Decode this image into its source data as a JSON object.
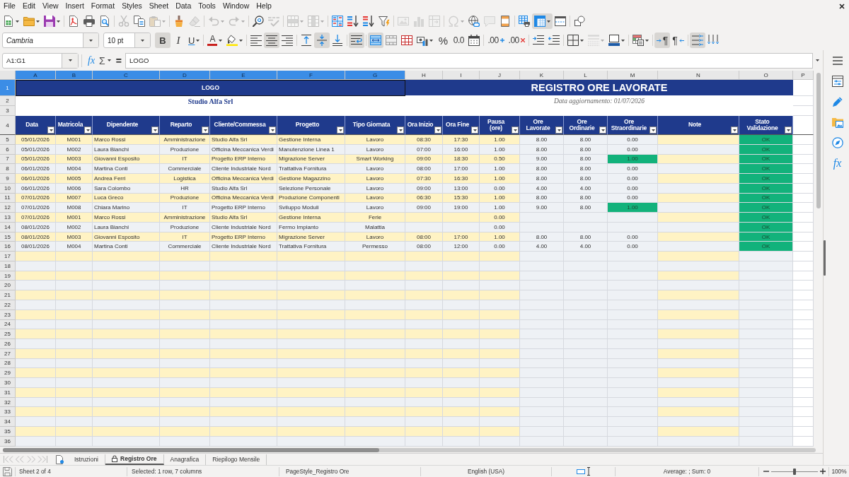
{
  "menu_bar": {
    "items": [
      "File",
      "Edit",
      "View",
      "Insert",
      "Format",
      "Styles",
      "Sheet",
      "Data",
      "Tools",
      "Window",
      "Help"
    ]
  },
  "standard_toolbar": [
    [
      {
        "kind": "new",
        "menu": true,
        "pressed": false,
        "disabled": false
      },
      {
        "kind": "open",
        "menu": true,
        "pressed": false,
        "disabled": false
      },
      {
        "kind": "save",
        "menu": true,
        "pressed": false,
        "disabled": false
      }
    ],
    [
      {
        "kind": "pdf",
        "menu": false,
        "pressed": false,
        "disabled": false
      },
      {
        "kind": "print",
        "menu": false,
        "pressed": false,
        "disabled": false
      },
      {
        "kind": "preview",
        "menu": false,
        "pressed": false,
        "disabled": false
      }
    ],
    [
      {
        "kind": "cut",
        "menu": false,
        "pressed": false,
        "disabled": true
      },
      {
        "kind": "copy",
        "menu": false,
        "pressed": false,
        "disabled": false
      },
      {
        "kind": "paste",
        "menu": true,
        "pressed": false,
        "disabled": true
      }
    ],
    [
      {
        "kind": "clone",
        "menu": false,
        "pressed": false,
        "disabled": false
      },
      {
        "kind": "clear",
        "menu": false,
        "pressed": false,
        "disabled": true
      }
    ],
    [
      {
        "kind": "undo",
        "menu": true,
        "pressed": false,
        "disabled": true
      },
      {
        "kind": "redo",
        "menu": true,
        "pressed": false,
        "disabled": true
      }
    ],
    [
      {
        "kind": "find",
        "menu": false,
        "pressed": false,
        "disabled": false
      },
      {
        "kind": "spelling",
        "menu": false,
        "pressed": false,
        "disabled": true
      }
    ],
    [
      {
        "kind": "rows",
        "menu": true,
        "pressed": false,
        "disabled": true
      },
      {
        "kind": "columns",
        "menu": true,
        "pressed": false,
        "disabled": true
      }
    ],
    [
      {
        "kind": "sort",
        "menu": false,
        "pressed": false,
        "disabled": false
      },
      {
        "kind": "ascending",
        "menu": false,
        "pressed": false,
        "disabled": false
      },
      {
        "kind": "descending",
        "menu": false,
        "pressed": false,
        "disabled": false
      },
      {
        "kind": "autofilter",
        "menu": false,
        "pressed": false,
        "disabled": false
      }
    ],
    [
      {
        "kind": "image",
        "menu": false,
        "pressed": false,
        "disabled": true
      },
      {
        "kind": "chart",
        "menu": false,
        "pressed": false,
        "disabled": true
      },
      {
        "kind": "pivot",
        "menu": false,
        "pressed": false,
        "disabled": true
      }
    ],
    [
      {
        "kind": "symbol",
        "menu": true,
        "pressed": false,
        "disabled": true
      },
      {
        "kind": "hyperlink",
        "menu": false,
        "pressed": false,
        "disabled": false
      },
      {
        "kind": "comment",
        "menu": false,
        "pressed": false,
        "disabled": true
      },
      {
        "kind": "headerfooter",
        "menu": false,
        "pressed": false,
        "disabled": false
      }
    ],
    [
      {
        "kind": "printarea",
        "menu": false,
        "pressed": false,
        "disabled": false
      },
      {
        "kind": "freeze",
        "menu": true,
        "pressed": true,
        "disabled": false
      },
      {
        "kind": "split",
        "menu": false,
        "pressed": false,
        "disabled": false
      }
    ],
    [
      {
        "kind": "shapes",
        "menu": false,
        "pressed": false,
        "disabled": false
      }
    ]
  ],
  "formatting_toolbar": {
    "font_name": "Cambria",
    "font_size": "10 pt",
    "groups": [
      [
        {
          "kind": "bold",
          "label": "B",
          "menu": false,
          "pressed": true,
          "disabled": false
        },
        {
          "kind": "italic",
          "label": "I",
          "menu": false,
          "pressed": false,
          "disabled": false
        },
        {
          "kind": "underline",
          "label": "U",
          "menu": true,
          "pressed": false,
          "disabled": false
        }
      ],
      [
        {
          "kind": "fontcolor",
          "label": "A",
          "menu": true,
          "pressed": false,
          "disabled": false
        },
        {
          "kind": "highlight",
          "menu": true,
          "pressed": false,
          "disabled": false
        }
      ],
      [
        {
          "kind": "left",
          "menu": false,
          "pressed": false,
          "disabled": false
        },
        {
          "kind": "center",
          "menu": false,
          "pressed": true,
          "disabled": false
        },
        {
          "kind": "right",
          "menu": false,
          "pressed": false,
          "disabled": false
        }
      ],
      [
        {
          "kind": "top",
          "menu": false,
          "pressed": false,
          "disabled": false
        },
        {
          "kind": "middle",
          "menu": false,
          "pressed": true,
          "disabled": false
        },
        {
          "kind": "bottom",
          "menu": false,
          "pressed": false,
          "disabled": false
        }
      ],
      [
        {
          "kind": "wrap",
          "menu": false,
          "pressed": true,
          "disabled": false
        }
      ],
      [
        {
          "kind": "mergecenter",
          "menu": false,
          "pressed": true,
          "disabled": false
        },
        {
          "kind": "merge",
          "menu": false,
          "pressed": false,
          "disabled": false
        },
        {
          "kind": "unmerge",
          "menu": false,
          "pressed": false,
          "disabled": false
        },
        {
          "kind": "currency",
          "menu": true,
          "pressed": false,
          "disabled": false
        },
        {
          "kind": "percent",
          "label": "%",
          "menu": false,
          "pressed": false,
          "disabled": false
        },
        {
          "kind": "number",
          "label": "0.0",
          "menu": false,
          "pressed": false,
          "disabled": false
        },
        {
          "kind": "date",
          "menu": false,
          "pressed": false,
          "disabled": false
        }
      ],
      [
        {
          "kind": "adddecimal",
          "label": ".00",
          "menu": false,
          "pressed": false,
          "disabled": false
        },
        {
          "kind": "deletedecimal",
          "label": ".00",
          "menu": false,
          "pressed": false,
          "disabled": false
        }
      ],
      [
        {
          "kind": "indent",
          "menu": false,
          "pressed": false,
          "disabled": false
        },
        {
          "kind": "outdent",
          "menu": false,
          "pressed": false,
          "disabled": false
        }
      ],
      [
        {
          "kind": "borders",
          "menu": true,
          "pressed": false,
          "disabled": false
        },
        {
          "kind": "borderstyle",
          "menu": true,
          "pressed": false,
          "disabled": true
        },
        {
          "kind": "bordercolor",
          "menu": true,
          "pressed": false,
          "disabled": false
        }
      ],
      [
        {
          "kind": "conditional",
          "menu": true,
          "pressed": false,
          "disabled": false
        }
      ],
      [
        {
          "kind": "ltr",
          "label": "¶",
          "menu": false,
          "pressed": true,
          "disabled": false
        },
        {
          "kind": "rtl",
          "label": "¶",
          "menu": false,
          "pressed": false,
          "disabled": false
        }
      ],
      [
        {
          "kind": "horizontal",
          "menu": false,
          "pressed": true,
          "disabled": false
        },
        {
          "kind": "vertical",
          "menu": false,
          "pressed": false,
          "disabled": false
        }
      ]
    ]
  },
  "formula_bar": {
    "name_box": "A1:G1",
    "function_wizard": "fx",
    "sum": "Σ",
    "equals": "=",
    "content": "LOGO"
  },
  "sheet": {
    "columns": [
      {
        "label": "A",
        "selected": true
      },
      {
        "label": "B",
        "selected": true
      },
      {
        "label": "C",
        "selected": true
      },
      {
        "label": "D",
        "selected": true
      },
      {
        "label": "E",
        "selected": true
      },
      {
        "label": "F",
        "selected": true
      },
      {
        "label": "G",
        "selected": true
      },
      {
        "label": "H",
        "selected": false
      },
      {
        "label": "I",
        "selected": false
      },
      {
        "label": "J",
        "selected": false
      },
      {
        "label": "K",
        "selected": false
      },
      {
        "label": "L",
        "selected": false
      },
      {
        "label": "M",
        "selected": false
      },
      {
        "label": "N",
        "selected": false
      },
      {
        "label": "O",
        "selected": false
      },
      {
        "label": "P",
        "selected": false
      }
    ],
    "row_numbers": [
      {
        "label": "1",
        "selected": true
      },
      {
        "label": "2",
        "selected": false
      },
      {
        "label": "3",
        "selected": false
      },
      {
        "label": "4",
        "selected": false
      },
      {
        "label": "5",
        "selected": false
      },
      {
        "label": "6",
        "selected": false
      },
      {
        "label": "7",
        "selected": false
      },
      {
        "label": "8",
        "selected": false
      },
      {
        "label": "9",
        "selected": false
      },
      {
        "label": "10",
        "selected": false
      },
      {
        "label": "11",
        "selected": false
      },
      {
        "label": "12",
        "selected": false
      },
      {
        "label": "13",
        "selected": false
      },
      {
        "label": "14",
        "selected": false
      },
      {
        "label": "15",
        "selected": false
      },
      {
        "label": "16",
        "selected": false
      },
      {
        "label": "17",
        "selected": false
      },
      {
        "label": "18",
        "selected": false
      },
      {
        "label": "19",
        "selected": false
      },
      {
        "label": "20",
        "selected": false
      },
      {
        "label": "21",
        "selected": false
      },
      {
        "label": "22",
        "selected": false
      },
      {
        "label": "23",
        "selected": false
      },
      {
        "label": "24",
        "selected": false
      },
      {
        "label": "25",
        "selected": false
      },
      {
        "label": "26",
        "selected": false
      },
      {
        "label": "27",
        "selected": false
      },
      {
        "label": "28",
        "selected": false
      },
      {
        "label": "29",
        "selected": false
      },
      {
        "label": "30",
        "selected": false
      },
      {
        "label": "31",
        "selected": false
      },
      {
        "label": "32",
        "selected": false
      },
      {
        "label": "33",
        "selected": false
      },
      {
        "label": "34",
        "selected": false
      },
      {
        "label": "35",
        "selected": false
      },
      {
        "label": "36",
        "selected": false
      }
    ],
    "logo": {
      "text": "LOGO",
      "selected": true
    },
    "title": "REGISTRO ORE LAVORATE",
    "company": "Studio Alfa Srl",
    "updated": "Data aggiornamento: 01/07/2026",
    "table": {
      "headers": [
        "Data",
        "Matricola",
        "Dipendente",
        "Reparto",
        "Cliente/Commessa",
        "Progetto",
        "Tipo Giornata",
        "Ora Inizio",
        "Ora Fine",
        "Pausa (ore)",
        "Ore Lavorate",
        "Ore Ordinarie",
        "Ore Straordinarie",
        "Note",
        "Stato Validazione"
      ],
      "rows": [
        {
          "date": "05/01/2026",
          "employee_id": "M001",
          "employee": "Marco Rossi",
          "department": "Amministrazione",
          "client": "Studio Alfa Srl",
          "project": "Gestione Interna",
          "day_type": "Lavoro",
          "start": "08:30",
          "end": "17:30",
          "break": "1.00",
          "worked": "8.00",
          "regular": "8.00",
          "overtime": "0.00",
          "status": "OK",
          "overtime_highlight": false,
          "validated": true
        },
        {
          "date": "05/01/2026",
          "employee_id": "M002",
          "employee": "Laura Bianchi",
          "department": "Produzione",
          "client": "Officina Meccanica Verdi",
          "project": "Manutenzione Linea 1",
          "day_type": "Lavoro",
          "start": "07:00",
          "end": "16:00",
          "break": "1.00",
          "worked": "8.00",
          "regular": "8.00",
          "overtime": "0.00",
          "status": "OK",
          "overtime_highlight": false,
          "validated": true
        },
        {
          "date": "05/01/2026",
          "employee_id": "M003",
          "employee": "Giovanni Esposito",
          "department": "IT",
          "client": "Progetto ERP Interno",
          "project": "Migrazione Server",
          "day_type": "Smart Working",
          "start": "09:00",
          "end": "18:30",
          "break": "0.50",
          "worked": "9.00",
          "regular": "8.00",
          "overtime": "1.00",
          "status": "OK",
          "overtime_highlight": true,
          "validated": true
        },
        {
          "date": "06/01/2026",
          "employee_id": "M004",
          "employee": "Martina Conti",
          "department": "Commerciale",
          "client": "Cliente Industriale Nord",
          "project": "Trattativa Fornitura",
          "day_type": "Lavoro",
          "start": "08:00",
          "end": "17:00",
          "break": "1.00",
          "worked": "8.00",
          "regular": "8.00",
          "overtime": "0.00",
          "status": "OK",
          "overtime_highlight": false,
          "validated": true
        },
        {
          "date": "06/01/2026",
          "employee_id": "M005",
          "employee": "Andrea Ferri",
          "department": "Logistica",
          "client": "Officina Meccanica Verdi",
          "project": "Gestione Magazzino",
          "day_type": "Lavoro",
          "start": "07:30",
          "end": "16:30",
          "break": "1.00",
          "worked": "8.00",
          "regular": "8.00",
          "overtime": "0.00",
          "status": "OK",
          "overtime_highlight": false,
          "validated": true
        },
        {
          "date": "06/01/2026",
          "employee_id": "M006",
          "employee": "Sara Colombo",
          "department": "HR",
          "client": "Studio Alfa Srl",
          "project": "Selezione Personale",
          "day_type": "Lavoro",
          "start": "09:00",
          "end": "13:00",
          "break": "0.00",
          "worked": "4.00",
          "regular": "4.00",
          "overtime": "0.00",
          "status": "OK",
          "overtime_highlight": false,
          "validated": true
        },
        {
          "date": "07/01/2026",
          "employee_id": "M007",
          "employee": "Luca Greco",
          "department": "Produzione",
          "client": "Officina Meccanica Verdi",
          "project": "Produzione Componenti",
          "day_type": "Lavoro",
          "start": "06:30",
          "end": "15:30",
          "break": "1.00",
          "worked": "8.00",
          "regular": "8.00",
          "overtime": "0.00",
          "status": "OK",
          "overtime_highlight": false,
          "validated": true
        },
        {
          "date": "07/01/2026",
          "employee_id": "M008",
          "employee": "Chiara Marino",
          "department": "IT",
          "client": "Progetto ERP Interno",
          "project": "Sviluppo Moduli",
          "day_type": "Lavoro",
          "start": "09:00",
          "end": "19:00",
          "break": "1.00",
          "worked": "9.00",
          "regular": "8.00",
          "overtime": "1.00",
          "status": "OK",
          "overtime_highlight": true,
          "validated": true
        },
        {
          "date": "07/01/2026",
          "employee_id": "M001",
          "employee": "Marco Rossi",
          "department": "Amministrazione",
          "client": "Studio Alfa Srl",
          "project": "Gestione Interna",
          "day_type": "Ferie",
          "break": "0.00",
          "status": "OK",
          "overtime_highlight": false,
          "validated": true
        },
        {
          "date": "08/01/2026",
          "employee_id": "M002",
          "employee": "Laura Bianchi",
          "department": "Produzione",
          "client": "Cliente Industriale Nord",
          "project": "Fermo Impianto",
          "day_type": "Malattia",
          "break": "0.00",
          "status": "OK",
          "overtime_highlight": false,
          "validated": true
        },
        {
          "date": "08/01/2026",
          "employee_id": "M003",
          "employee": "Giovanni Esposito",
          "department": "IT",
          "client": "Progetto ERP Interno",
          "project": "Migrazione Server",
          "day_type": "Lavoro",
          "start": "08:00",
          "end": "17:00",
          "break": "1.00",
          "worked": "8.00",
          "regular": "8.00",
          "overtime": "0.00",
          "status": "OK",
          "overtime_highlight": false,
          "validated": true
        },
        {
          "date": "08/01/2026",
          "employee_id": "M004",
          "employee": "Martina Conti",
          "department": "Commerciale",
          "client": "Cliente Industriale Nord",
          "project": "Trattativa Fornitura",
          "day_type": "Permesso",
          "start": "08:00",
          "end": "12:00",
          "break": "0.00",
          "worked": "4.00",
          "regular": "4.00",
          "overtime": "0.00",
          "status": "OK",
          "overtime_highlight": false,
          "validated": true
        }
      ]
    }
  },
  "sidebar": {
    "decks": [
      {
        "kind": "properties",
        "selected": false
      },
      {
        "kind": "styles",
        "selected": false
      },
      {
        "kind": "gallery",
        "selected": false
      },
      {
        "kind": "navigator",
        "selected": false
      },
      {
        "kind": "functions",
        "label": "fx",
        "selected": false
      }
    ]
  },
  "sheet_tabs": {
    "navigation": [
      {
        "kind": "first",
        "disabled": true
      },
      {
        "kind": "previous",
        "disabled": true
      },
      {
        "kind": "next",
        "disabled": true
      },
      {
        "kind": "last",
        "disabled": true
      }
    ],
    "tabs": [
      {
        "label": "Istruzioni",
        "selected": false,
        "locked": false
      },
      {
        "label": "Registro Ore",
        "selected": true,
        "locked": true
      },
      {
        "label": "Anagrafica",
        "selected": false,
        "locked": false
      },
      {
        "label": "Riepilogo Mensile",
        "selected": false,
        "locked": false
      }
    ]
  },
  "status_bar": {
    "sheet": "Sheet 2 of 4",
    "selection": "Selected: 1 row, 7 columns",
    "page_style": "PageStyle_Registro Ore",
    "language": "English (USA)",
    "summary": "Average: ; Sum: 0",
    "zoom": {
      "level": 0.5,
      "reading": "100%"
    }
  }
}
